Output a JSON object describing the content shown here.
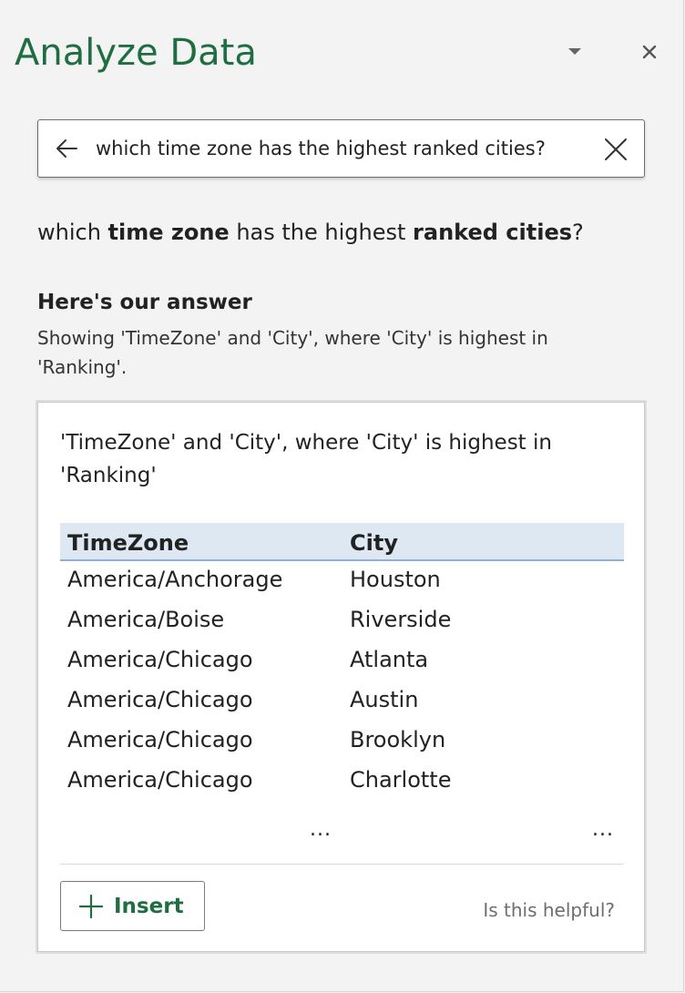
{
  "header": {
    "title": "Analyze Data",
    "dropdown_icon": "chevron-down-icon",
    "close_icon": "close-icon"
  },
  "search": {
    "value": "which time zone has the highest ranked cities?",
    "back_icon": "arrow-left-icon",
    "clear_icon": "close-icon"
  },
  "question": {
    "part1": "which ",
    "bold1": "time zone",
    "part2": " has the highest ",
    "bold2": "ranked cities",
    "part3": "?"
  },
  "answer": {
    "heading": "Here's our answer",
    "description": "Showing 'TimeZone' and 'City', where 'City' is highest in 'Ranking'."
  },
  "card": {
    "title": "'TimeZone' and 'City', where 'City' is highest in 'Ranking'",
    "table": {
      "headers": [
        "TimeZone",
        "City"
      ],
      "rows": [
        [
          "America/Anchorage",
          "Houston"
        ],
        [
          "America/Boise",
          "Riverside"
        ],
        [
          "America/Chicago",
          "Atlanta"
        ],
        [
          "America/Chicago",
          "Austin"
        ],
        [
          "America/Chicago",
          "Brooklyn"
        ],
        [
          "America/Chicago",
          "Charlotte"
        ]
      ],
      "more": "...",
      "more2": "..."
    },
    "insert_label": "Insert",
    "insert_icon": "plus-icon",
    "helpful_label": "Is this helpful?"
  },
  "colors": {
    "accent": "#1e6e42",
    "header_bg": "#dde8f3",
    "header_border": "#8fb0d0",
    "pane_bg": "#f3f3f3"
  }
}
